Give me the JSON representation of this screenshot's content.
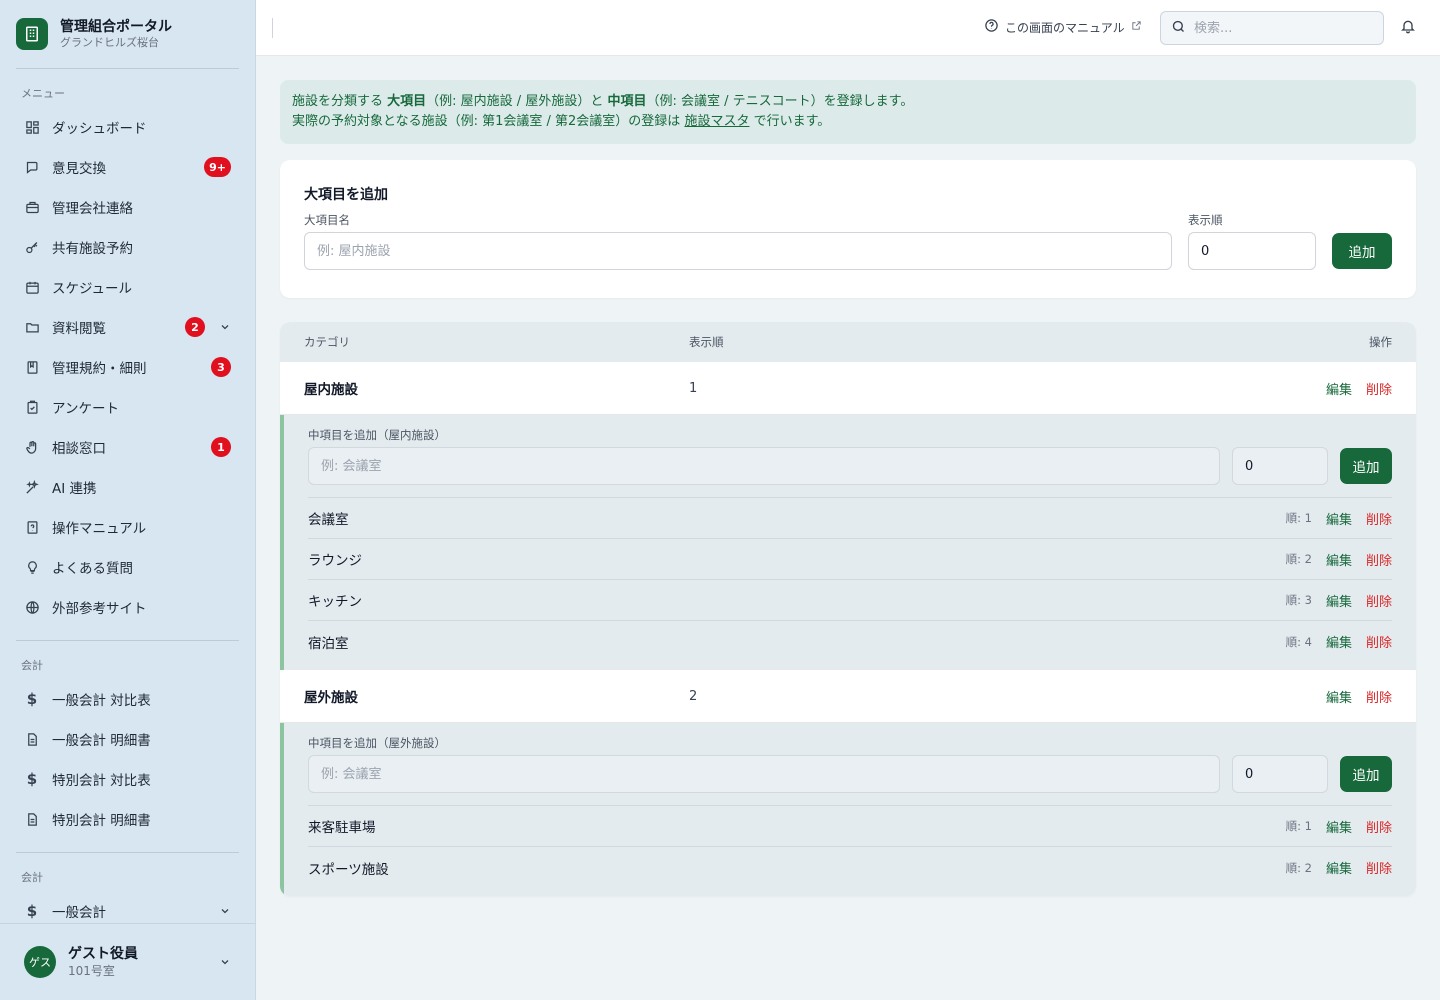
{
  "brand": {
    "title": "管理組合ポータル",
    "subtitle": "グランドヒルズ桜台"
  },
  "sidebar": {
    "menu_label": "メニュー",
    "items": [
      {
        "label": "ダッシュボード",
        "icon": "dashboard-icon"
      },
      {
        "label": "意見交換",
        "icon": "chat-icon",
        "badge": "9+"
      },
      {
        "label": "管理会社連絡",
        "icon": "briefcase-icon"
      },
      {
        "label": "共有施設予約",
        "icon": "key-icon"
      },
      {
        "label": "スケジュール",
        "icon": "calendar-icon"
      },
      {
        "label": "資料閲覧",
        "icon": "folder-icon",
        "badge": "2"
      },
      {
        "label": "管理規約・細則",
        "icon": "book-icon",
        "badge": "3"
      },
      {
        "label": "アンケート",
        "icon": "clipboard-icon"
      },
      {
        "label": "相談窓口",
        "icon": "hand-icon",
        "badge": "1"
      },
      {
        "label": "AI 連携",
        "icon": "sparkle-icon"
      },
      {
        "label": "操作マニュアル",
        "icon": "manual-icon"
      },
      {
        "label": "よくある質問",
        "icon": "lightbulb-icon"
      },
      {
        "label": "外部参考サイト",
        "icon": "globe-icon"
      }
    ],
    "accounting_label": "会計",
    "accounting_items": [
      {
        "label": "一般会計 対比表",
        "icon": "dollar-icon"
      },
      {
        "label": "一般会計 明細書",
        "icon": "document-icon"
      },
      {
        "label": "特別会計 対比表",
        "icon": "dollar-icon"
      },
      {
        "label": "特別会計 明細書",
        "icon": "document-icon"
      }
    ],
    "accounting_label2": "会計",
    "accounting_items2": [
      {
        "label": "一般会計",
        "icon": "dollar-icon"
      }
    ]
  },
  "user": {
    "avatar": "ゲス",
    "name": "ゲスト役員",
    "room": "101号室"
  },
  "topbar": {
    "manual_link": "この画面のマニュアル",
    "search_placeholder": "検索..."
  },
  "info": {
    "line1_a": "施設を分類する ",
    "line1_b": "大項目",
    "line1_c": "（例: 屋内施設 / 屋外施設）と ",
    "line1_d": "中項目",
    "line1_e": "（例: 会議室 / テニスコート）を登録します。",
    "line2_a": "実際の予約対象となる施設（例: 第1会議室 / 第2会議室）の登録は ",
    "line2_link": "施設マスタ",
    "line2_b": " で行います。"
  },
  "add_category": {
    "title": "大項目を追加",
    "name_label": "大項目名",
    "name_placeholder": "例: 屋内施設",
    "order_label": "表示順",
    "order_value": "0",
    "button": "追加"
  },
  "table": {
    "headers": {
      "category": "カテゴリ",
      "order": "表示順",
      "actions": "操作"
    },
    "edit_label": "編集",
    "delete_label": "削除",
    "categories": [
      {
        "name": "屋内施設",
        "order": "1",
        "sub_add_label": "中項目を追加（屋内施設）",
        "sub_placeholder": "例: 会議室",
        "sub_order_value": "0",
        "sub_button": "追加",
        "subs": [
          {
            "name": "会議室",
            "order": "順: 1"
          },
          {
            "name": "ラウンジ",
            "order": "順: 2"
          },
          {
            "name": "キッチン",
            "order": "順: 3"
          },
          {
            "name": "宿泊室",
            "order": "順: 4"
          }
        ]
      },
      {
        "name": "屋外施設",
        "order": "2",
        "sub_add_label": "中項目を追加（屋外施設）",
        "sub_placeholder": "例: 会議室",
        "sub_order_value": "0",
        "sub_button": "追加",
        "subs": [
          {
            "name": "来客駐車場",
            "order": "順: 1"
          },
          {
            "name": "スポーツ施設",
            "order": "順: 2"
          }
        ]
      }
    ]
  },
  "colors": {
    "brand_green": "#17693c",
    "danger_red": "#dc2626",
    "badge_red": "#e0101f",
    "sidebar_bg": "#d7e6f0"
  }
}
